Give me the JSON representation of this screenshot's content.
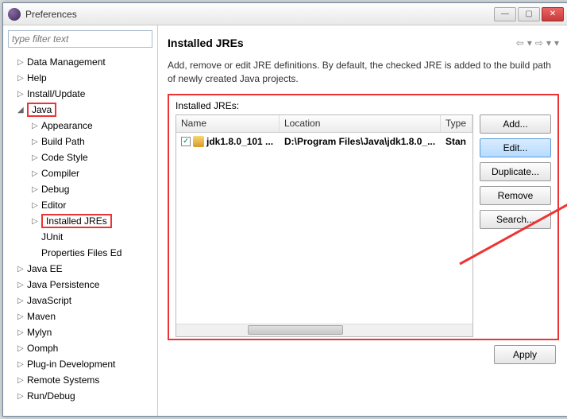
{
  "window": {
    "title": "Preferences"
  },
  "filter": {
    "placeholder": "type filter text"
  },
  "tree": [
    {
      "label": "Data Management",
      "indent": 1,
      "arrow": "▷"
    },
    {
      "label": "Help",
      "indent": 1,
      "arrow": "▷"
    },
    {
      "label": "Install/Update",
      "indent": 1,
      "arrow": "▷"
    },
    {
      "label": "Java",
      "indent": 1,
      "arrow": "◢",
      "hl": true
    },
    {
      "label": "Appearance",
      "indent": 2,
      "arrow": "▷"
    },
    {
      "label": "Build Path",
      "indent": 2,
      "arrow": "▷"
    },
    {
      "label": "Code Style",
      "indent": 2,
      "arrow": "▷"
    },
    {
      "label": "Compiler",
      "indent": 2,
      "arrow": "▷"
    },
    {
      "label": "Debug",
      "indent": 2,
      "arrow": "▷"
    },
    {
      "label": "Editor",
      "indent": 2,
      "arrow": "▷"
    },
    {
      "label": "Installed JREs",
      "indent": 2,
      "arrow": "▷",
      "hl": true,
      "selected": false
    },
    {
      "label": "JUnit",
      "indent": 2,
      "arrow": ""
    },
    {
      "label": "Properties Files Ed",
      "indent": 2,
      "arrow": ""
    },
    {
      "label": "Java EE",
      "indent": 1,
      "arrow": "▷"
    },
    {
      "label": "Java Persistence",
      "indent": 1,
      "arrow": "▷"
    },
    {
      "label": "JavaScript",
      "indent": 1,
      "arrow": "▷"
    },
    {
      "label": "Maven",
      "indent": 1,
      "arrow": "▷"
    },
    {
      "label": "Mylyn",
      "indent": 1,
      "arrow": "▷"
    },
    {
      "label": "Oomph",
      "indent": 1,
      "arrow": "▷"
    },
    {
      "label": "Plug-in Development",
      "indent": 1,
      "arrow": "▷"
    },
    {
      "label": "Remote Systems",
      "indent": 1,
      "arrow": "▷"
    },
    {
      "label": "Run/Debug",
      "indent": 1,
      "arrow": "▷"
    }
  ],
  "content": {
    "heading": "Installed JREs",
    "description": "Add, remove or edit JRE definitions. By default, the checked JRE is added to the build path of newly created Java projects.",
    "label": "Installed JREs:",
    "columns": {
      "name": "Name",
      "location": "Location",
      "type": "Type"
    },
    "rows": [
      {
        "checked": true,
        "name": "jdk1.8.0_101 ...",
        "location": "D:\\Program Files\\Java\\jdk1.8.0_...",
        "type": "Stan"
      }
    ]
  },
  "buttons": {
    "add": "Add...",
    "edit": "Edit...",
    "duplicate": "Duplicate...",
    "remove": "Remove",
    "search": "Search...",
    "apply": "Apply"
  }
}
